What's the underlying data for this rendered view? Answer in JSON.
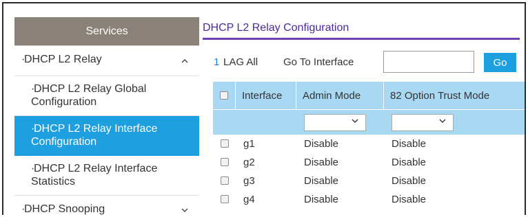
{
  "sidebar": {
    "header": "Services",
    "items": [
      {
        "label": "DHCP L2 Relay",
        "icon": "chevron-up-icon"
      },
      {
        "label": "DHCP L2 Relay Global Configuration"
      },
      {
        "label": "DHCP L2 Relay Interface Configuration",
        "active": true
      },
      {
        "label": "DHCP L2 Relay Interface Statistics"
      },
      {
        "label": "DHCP Snooping",
        "icon": "chevron-down-icon"
      }
    ]
  },
  "main": {
    "title": "DHCP L2 Relay Configuration",
    "toolbar": {
      "lag_link": "1",
      "lag_text": "LAG All",
      "goto_label": "Go To Interface",
      "goto_value": "",
      "go_label": "Go"
    },
    "table": {
      "headers": [
        "Interface",
        "Admin Mode",
        "82 Option Trust Mode"
      ],
      "rows": [
        {
          "interface": "g1",
          "admin": "Disable",
          "trust": "Disable"
        },
        {
          "interface": "g2",
          "admin": "Disable",
          "trust": "Disable"
        },
        {
          "interface": "g3",
          "admin": "Disable",
          "trust": "Disable"
        },
        {
          "interface": "g4",
          "admin": "Disable",
          "trust": "Disable"
        }
      ]
    }
  },
  "colors": {
    "accent": "#1e9fe0",
    "sidebar_header": "#8a8178",
    "table_header": "#a9d8f3",
    "title_underline": "#6b3fb8"
  }
}
